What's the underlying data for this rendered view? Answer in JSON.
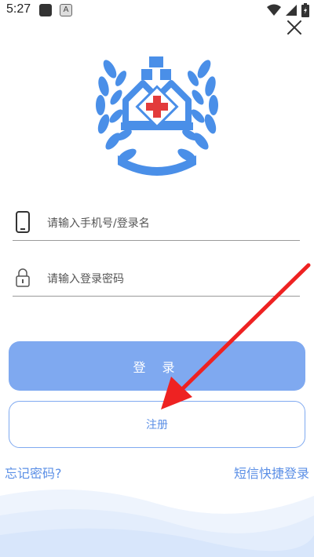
{
  "status": {
    "time": "5:27"
  },
  "form": {
    "phone_placeholder": "请输入手机号/登录名",
    "password_placeholder": "请输入登录密码"
  },
  "buttons": {
    "login_label": "登 录",
    "register_label": "注册"
  },
  "links": {
    "forgot": "忘记密码?",
    "sms_login": "短信快捷登录"
  },
  "colors": {
    "primary": "#7fa9f0",
    "link": "#5b8fe6",
    "logo_blue": "#4a8fe8",
    "logo_cross": "#e23b3b",
    "annotation_arrow": "#ee2222"
  },
  "icons": [
    "close-icon",
    "phone-icon",
    "lock-icon",
    "wifi-icon",
    "battery-icon"
  ]
}
